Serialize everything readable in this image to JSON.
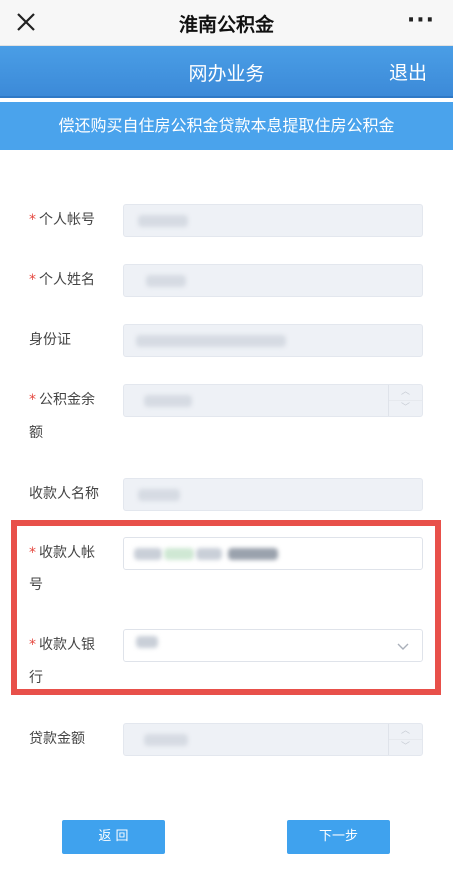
{
  "topbar": {
    "title": "淮南公积金",
    "more": "···",
    "close_icon": "close-icon"
  },
  "navbar": {
    "title": "网办业务",
    "logout": "退出"
  },
  "banner": {
    "text": "偿还购买自住房公积金贷款本息提取住房公积金"
  },
  "fields": [
    {
      "label_line1": "个人帐号",
      "label_line2": "",
      "required": "*"
    },
    {
      "label_line1": "个人姓名",
      "label_line2": "",
      "required": "*"
    },
    {
      "label_line1": "身份证",
      "label_line2": "",
      "required": ""
    },
    {
      "label_line1": "公积金余",
      "label_line2": "额",
      "required": "*"
    },
    {
      "label_line1": "收款人名称",
      "label_line2": "",
      "required": ""
    },
    {
      "label_line1": "收款人帐",
      "label_line2": "号",
      "required": "*"
    },
    {
      "label_line1": "收款人银",
      "label_line2": "行",
      "required": "*"
    },
    {
      "label_line1": "贷款金额",
      "label_line2": "",
      "required": ""
    }
  ],
  "buttons": {
    "back": "返 回",
    "next": "下一步"
  },
  "colors": {
    "accent": "#4aa3ec",
    "required": "#e5483f",
    "highlight": "#e8504a"
  }
}
